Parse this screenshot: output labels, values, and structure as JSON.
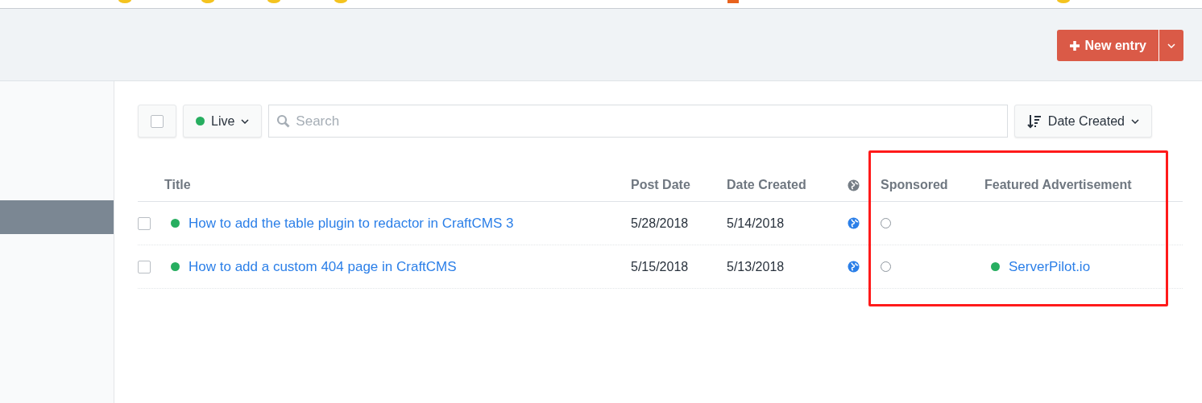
{
  "header": {
    "new_entry_button": {
      "label": "New entry"
    }
  },
  "sidebar": {
    "items": [
      {
        "selected": true
      }
    ]
  },
  "toolbar": {
    "select_all": {
      "checked": false
    },
    "status_filter": {
      "label": "Live",
      "color": "#27ae60"
    },
    "search": {
      "placeholder": "Search"
    },
    "sort": {
      "label": "Date Created"
    }
  },
  "table": {
    "columns": [
      {
        "kind": "check"
      },
      {
        "kind": "text",
        "label": "Title"
      },
      {
        "kind": "text",
        "label": "Post Date"
      },
      {
        "kind": "text",
        "label": "Date Created"
      },
      {
        "kind": "globe"
      },
      {
        "kind": "text",
        "label": "Sponsored"
      },
      {
        "kind": "text",
        "label": "Featured Advertisement"
      }
    ],
    "rows": [
      {
        "checked": false,
        "color": "#27ae60",
        "title": "How to add the table plugin to redactor in CraftCMS 3",
        "post_date": "5/28/2018",
        "date_created": "5/14/2018",
        "sponsored": false
      },
      {
        "checked": false,
        "color": "#27ae60",
        "title": "How to add a custom 404 page in CraftCMS",
        "post_date": "5/15/2018",
        "date_created": "5/13/2018",
        "sponsored": false,
        "featured": {
          "color": "#27ae60",
          "label": "ServerPilot.io"
        }
      }
    ]
  },
  "annotations": [
    {
      "kind": "highlight-box"
    }
  ]
}
